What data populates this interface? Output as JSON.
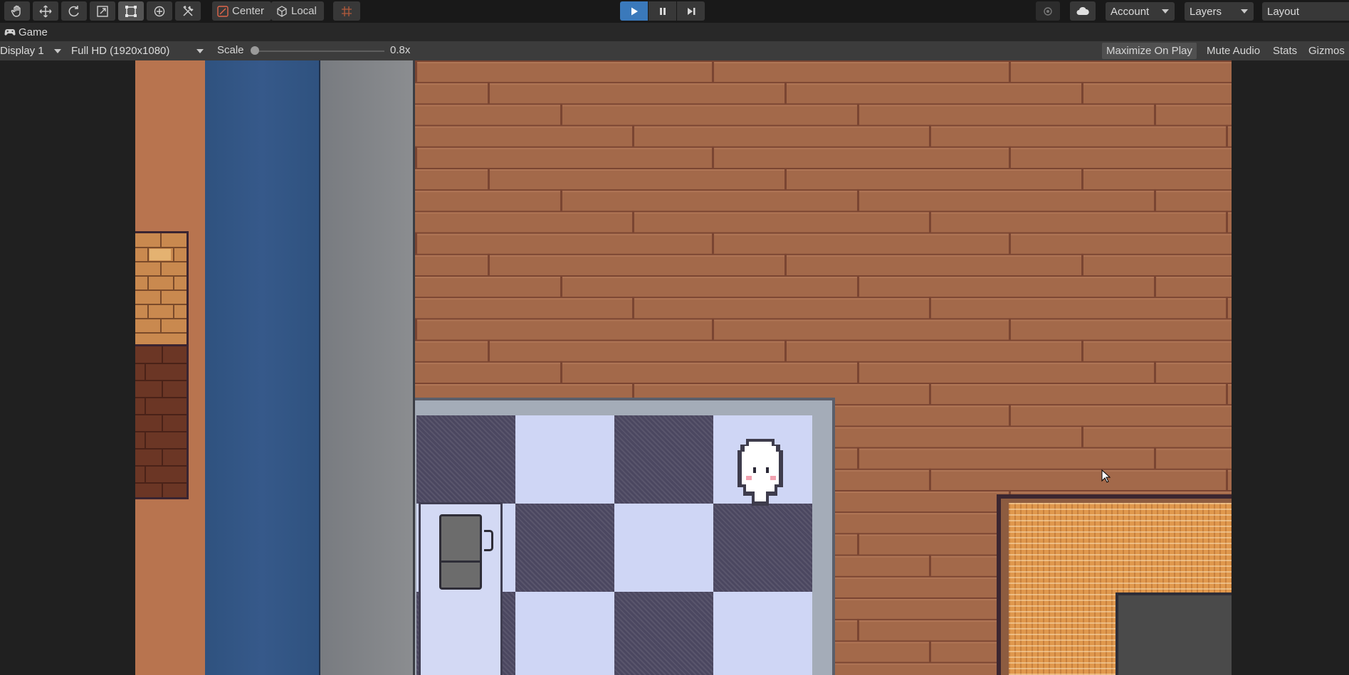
{
  "toolbar": {
    "tools": [
      {
        "name": "hand-tool",
        "icon": "hand-icon"
      },
      {
        "name": "move-tool",
        "icon": "move-arrows-icon"
      },
      {
        "name": "rotate-tool",
        "icon": "rotate-icon"
      },
      {
        "name": "scale-tool",
        "icon": "scale-icon"
      },
      {
        "name": "rect-tool",
        "icon": "rect-transform-icon",
        "selected": true
      },
      {
        "name": "transform-tool",
        "icon": "transform-icon"
      },
      {
        "name": "custom-tool",
        "icon": "tools-icon"
      }
    ],
    "pivot_label": "Center",
    "space_label": "Local",
    "snap_icon": "grid-snap-icon",
    "play_icon": "play-icon",
    "pause_icon": "pause-icon",
    "step_icon": "step-icon",
    "account_label": "Account",
    "layers_label": "Layers",
    "layout_label": "Layout",
    "accent_color": "#3a79bb"
  },
  "tab": {
    "icon": "gamepad-icon",
    "label": "Game"
  },
  "gamebar": {
    "display_label": "Display 1",
    "resolution_label": "Full HD (1920x1080)",
    "scale_label": "Scale",
    "scale_value": "0.8x",
    "scale_fraction": 0.0,
    "maximize_label": "Maximize On Play",
    "maximize_on": true,
    "mute_label": "Mute Audio",
    "stats_label": "Stats",
    "gizmos_label": "Gizmos"
  },
  "scene": {
    "floor_color": "#a3694a",
    "water_color": "#36598a",
    "character": "white-ghost-character"
  }
}
